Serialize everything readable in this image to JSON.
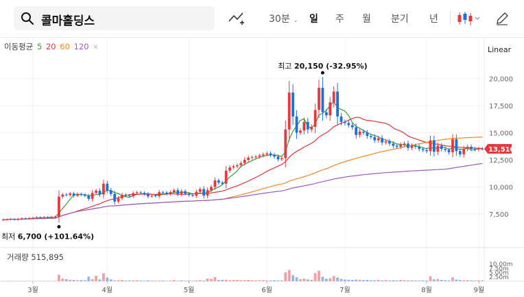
{
  "search": {
    "value": "콜마홀딩스",
    "icon": "search-icon"
  },
  "toolbar": {
    "draw_icon": "chart-draw-icon",
    "interval": "30분",
    "periods": [
      "일",
      "주",
      "월",
      "분기",
      "년"
    ],
    "active_period": "일",
    "candle_icon": "candlestick-icon",
    "edit_icon": "pencil-icon"
  },
  "ma_legend": {
    "label": "이동평균",
    "periods": [
      "5",
      "20",
      "60",
      "120"
    ],
    "colors": [
      "#3a9a3a",
      "#e0343a",
      "#f0861f",
      "#9b59c6"
    ],
    "close_icon": "close-icon"
  },
  "scale": "Linear",
  "volume": {
    "label": "거래량",
    "value": "515,895",
    "ticks": [
      "10.00m",
      "7.50m",
      "5.00m",
      "2.50m"
    ]
  },
  "chart_data": {
    "type": "candlestick",
    "x_ticks": [
      "3월",
      "4월",
      "5월",
      "6월",
      "7월",
      "8월",
      "9월"
    ],
    "y_ticks": [
      "20,000",
      "17,500",
      "15,000",
      "12,500",
      "10,000",
      "7,500"
    ],
    "ylim": [
      5800,
      21500
    ],
    "high_annotation": {
      "label": "최고",
      "value": "20,150",
      "change": "(-32.95%)"
    },
    "low_annotation": {
      "label": "최저",
      "value": "6,700",
      "change": "(+101.64%)"
    },
    "last_price": "13,510",
    "colors": {
      "up": "#e8383d",
      "down": "#1e6fd9",
      "price_tag": "#e8383d"
    },
    "close": [
      6980,
      7000,
      7030,
      6990,
      7050,
      7100,
      7080,
      7120,
      7150,
      7200,
      7180,
      7210,
      7190,
      7230,
      7250,
      9100,
      9300,
      9250,
      9400,
      9200,
      9350,
      9280,
      9180,
      8900,
      9450,
      9650,
      9300,
      10300,
      9700,
      9350,
      8650,
      8950,
      9280,
      9200,
      9150,
      9420,
      9500,
      9450,
      9350,
      9120,
      9200,
      9150,
      9520,
      9480,
      9350,
      9520,
      9700,
      9350,
      9600,
      9380,
      9250,
      9180,
      9550,
      9800,
      9200,
      9700,
      10000,
      10600,
      10400,
      10300,
      11500,
      11800,
      11900,
      12000,
      12200,
      12500,
      12700,
      12750,
      12800,
      12900,
      13000,
      13100,
      12950,
      12800,
      12550,
      12650,
      15300,
      18700,
      16500,
      15000,
      15200,
      16000,
      15300,
      15550,
      17100,
      19150,
      16900,
      16600,
      17800,
      18800,
      16500,
      16000,
      15900,
      15700,
      15500,
      14800,
      15100,
      15000,
      14700,
      14600,
      14300,
      14500,
      14100,
      14200,
      14000,
      13800,
      13700,
      13900,
      14000,
      13600,
      13800,
      13700,
      13500,
      13400,
      13300,
      14300,
      13250,
      13800,
      13500,
      13400,
      13200,
      14400,
      13300,
      13000,
      13500,
      13700,
      13500,
      13450,
      13520,
      13510
    ],
    "volume_millions": [
      0.2,
      0.2,
      0.2,
      0.2,
      0.2,
      0.2,
      0.2,
      0.2,
      0.2,
      0.2,
      0.2,
      0.2,
      0.2,
      0.2,
      0.2,
      3.8,
      1.6,
      1.2,
      0.9,
      0.8,
      0.6,
      0.7,
      0.6,
      2.7,
      1.2,
      3.2,
      1.1,
      4.6,
      2.2,
      1.1,
      0.5,
      0.6,
      0.7,
      0.4,
      0.5,
      0.5,
      0.6,
      0.4,
      0.3,
      0.5,
      0.4,
      0.3,
      0.4,
      0.4,
      0.3,
      0.4,
      0.7,
      0.3,
      0.6,
      0.3,
      0.4,
      0.3,
      0.5,
      0.6,
      0.4,
      1.6,
      1.4,
      2.4,
      0.8,
      0.8,
      0.9,
      0.6,
      0.7,
      0.8,
      0.6,
      0.7,
      0.8,
      0.6,
      0.5,
      0.5,
      0.6,
      0.5,
      0.5,
      0.6,
      0.5,
      0.5,
      5.2,
      6.6,
      3.5,
      2.3,
      1.2,
      1.6,
      1.1,
      0.9,
      4.8,
      6.2,
      2.7,
      1.5,
      1.8,
      3.0,
      2.2,
      1.4,
      1.0,
      0.9,
      0.8,
      1.0,
      0.9,
      0.7,
      0.8,
      0.6,
      0.6,
      0.9,
      0.5,
      0.7,
      0.5,
      0.6,
      0.5,
      0.8,
      0.6,
      0.5,
      0.6,
      0.5,
      0.4,
      0.5,
      0.4,
      2.9,
      1.1,
      1.3,
      0.8,
      0.6,
      0.5,
      2.3,
      1.0,
      0.7,
      0.6,
      0.7,
      0.5,
      0.4,
      0.5,
      0.5
    ]
  }
}
